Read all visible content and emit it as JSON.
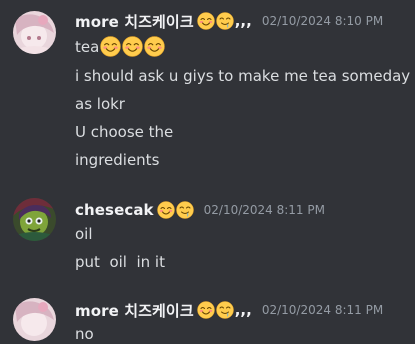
{
  "messages": [
    {
      "username": "more 치즈케이크",
      "name_suffix": ",,,",
      "name_emojis": [
        "drooling-face-emoji",
        "drooling-face-emoji"
      ],
      "timestamp": "02/10/2024 8:10 PM",
      "lines": [
        {
          "text": "tea",
          "emojis": [
            "smiling-face-emoji",
            "smiling-face-emoji",
            "smiling-face-emoji"
          ]
        },
        {
          "text": "i should ask u giys to make me tea someday"
        },
        {
          "text": "as lokr"
        },
        {
          "text": "U choose the"
        },
        {
          "text": "ingredients"
        }
      ]
    },
    {
      "username": "chesecak",
      "name_emojis": [
        "smiling-face-emoji",
        "drooling-face-emoji"
      ],
      "timestamp": "02/10/2024 8:11 PM",
      "lines": [
        {
          "text": "oil"
        },
        {
          "text": "put  oil  in it"
        }
      ]
    },
    {
      "username": "more 치즈케이크",
      "name_suffix": ",,,",
      "name_emojis": [
        "drooling-face-emoji",
        "drooling-face-emoji"
      ],
      "timestamp": "02/10/2024 8:11 PM",
      "lines": [
        {
          "text": "no"
        }
      ]
    }
  ]
}
